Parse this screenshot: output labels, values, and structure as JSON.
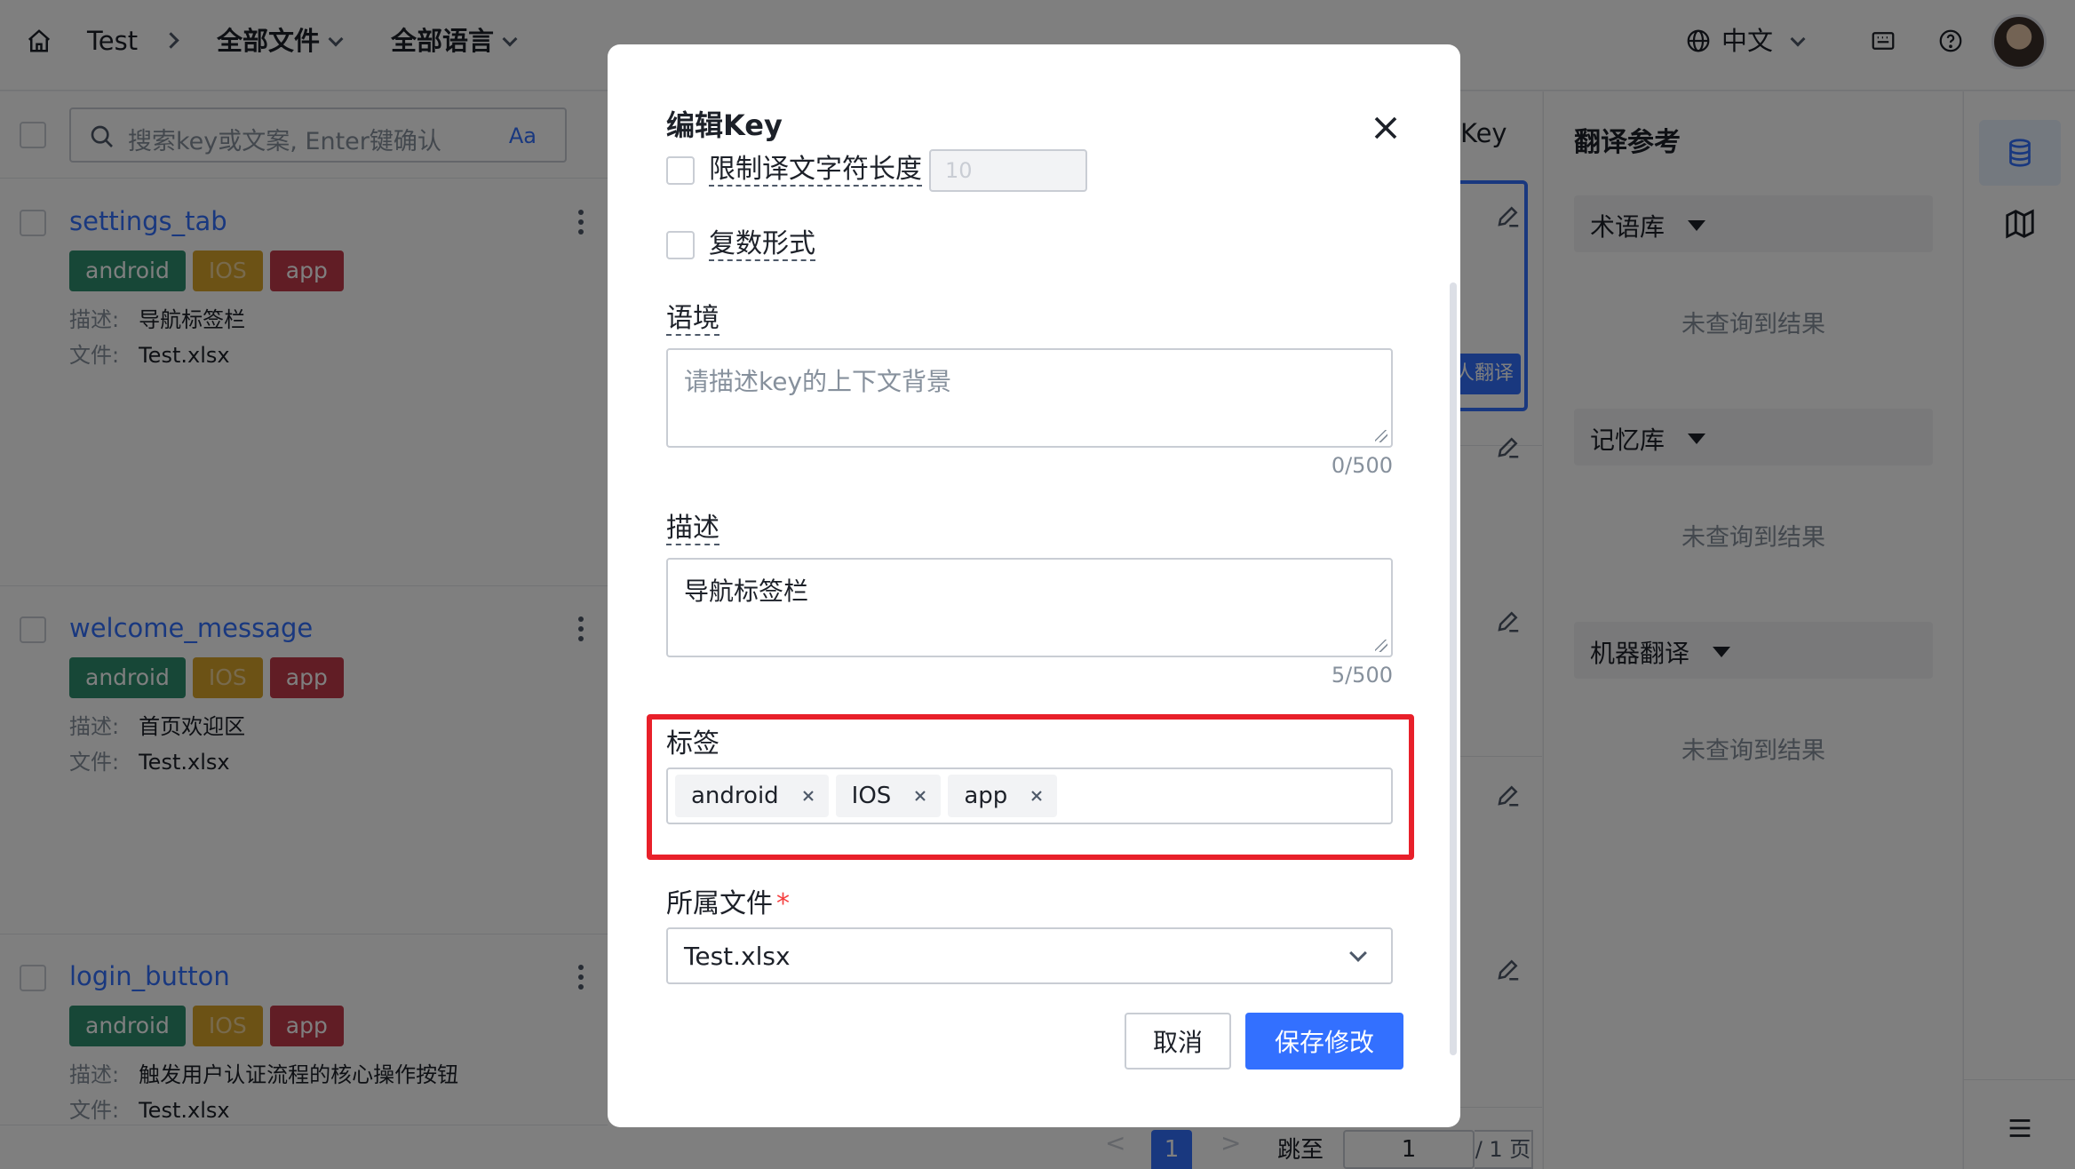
{
  "header": {
    "project": "Test",
    "file_filter": "全部文件",
    "lang_filter": "全部语言",
    "ui_language": "中文"
  },
  "left": {
    "search_placeholder": "搜索key或文案, Enter键确认",
    "case_toggle": "Aa",
    "desc_label": "描述:",
    "file_label": "文件:",
    "items": [
      {
        "key": "settings_tab",
        "tags": [
          "android",
          "IOS",
          "app"
        ],
        "desc": "导航标签栏",
        "file": "Test.xlsx"
      },
      {
        "key": "welcome_message",
        "tags": [
          "android",
          "IOS",
          "app"
        ],
        "desc": "首页欢迎区",
        "file": "Test.xlsx"
      },
      {
        "key": "login_button",
        "tags": [
          "android",
          "IOS",
          "app"
        ],
        "desc": "触发用户认证流程的核心操作按钮",
        "file": "Test.xlsx"
      }
    ]
  },
  "middle": {
    "header_partial": "Key",
    "button_partial": "人翻译"
  },
  "pager": {
    "prev": "<",
    "current": "1",
    "next": ">",
    "goto_label": "跳至",
    "goto_value": "1",
    "total": "/ 1 页"
  },
  "right": {
    "title": "翻译参考",
    "sections": [
      {
        "label": "术语库",
        "empty": "未查询到结果"
      },
      {
        "label": "记忆库",
        "empty": "未查询到结果"
      },
      {
        "label": "机器翻译",
        "empty": "未查询到结果"
      }
    ]
  },
  "modal": {
    "title": "编辑Key",
    "limit_label": "限制译文字符长度",
    "limit_placeholder": "10",
    "plural_label": "复数形式",
    "context_label": "语境",
    "context_placeholder": "请描述key的上下文背景",
    "context_count": "0/500",
    "desc_label": "描述",
    "desc_value": "导航标签栏",
    "desc_count": "5/500",
    "tags_label": "标签",
    "tags": [
      "android",
      "IOS",
      "app"
    ],
    "file_label": "所属文件",
    "required_mark": "*",
    "file_value": "Test.xlsx",
    "cancel": "取消",
    "save": "保存修改"
  },
  "colors": {
    "accent": "#3370ff",
    "tag_android": "#2f8f6f",
    "tag_ios": "#d9a52a",
    "tag_app": "#c23a4a",
    "highlight": "#e8202a"
  }
}
